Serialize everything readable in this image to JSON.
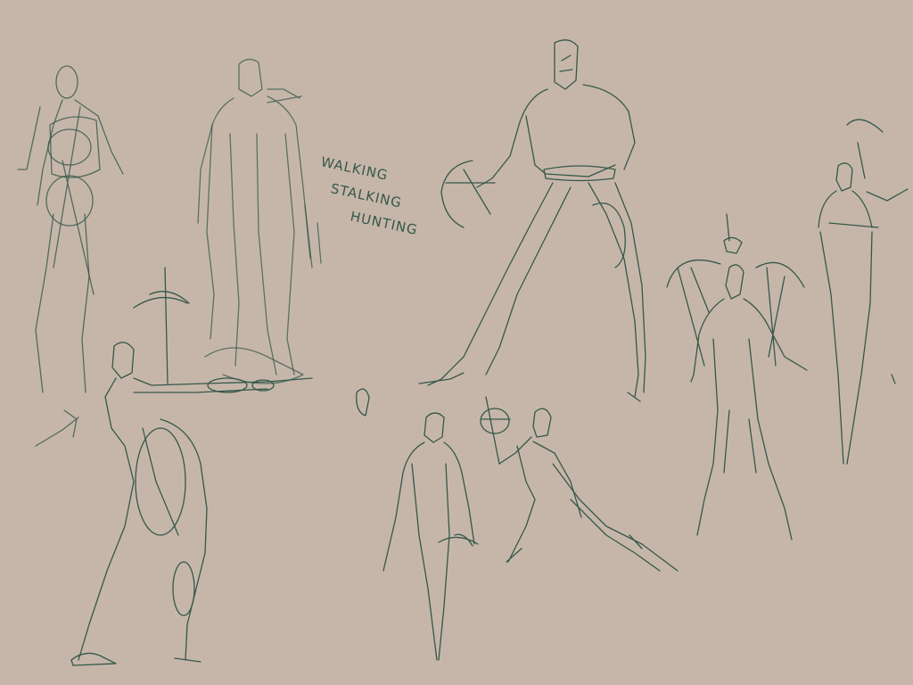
{
  "canvas": {
    "background": "#c6b6aa",
    "ink": "#35584a",
    "ink_light": "#5a7a6c"
  },
  "annotations": {
    "line1": "WALKING",
    "line2": "STALKING",
    "line3": "HUNTING"
  },
  "figures": [
    "standing-figure-left",
    "cloaked-figure",
    "crossbow-stance-figure",
    "archer-aiming-figure",
    "walking-figure-back",
    "crouching-crossbow-figure",
    "figure-with-bows",
    "slender-figure-right"
  ]
}
